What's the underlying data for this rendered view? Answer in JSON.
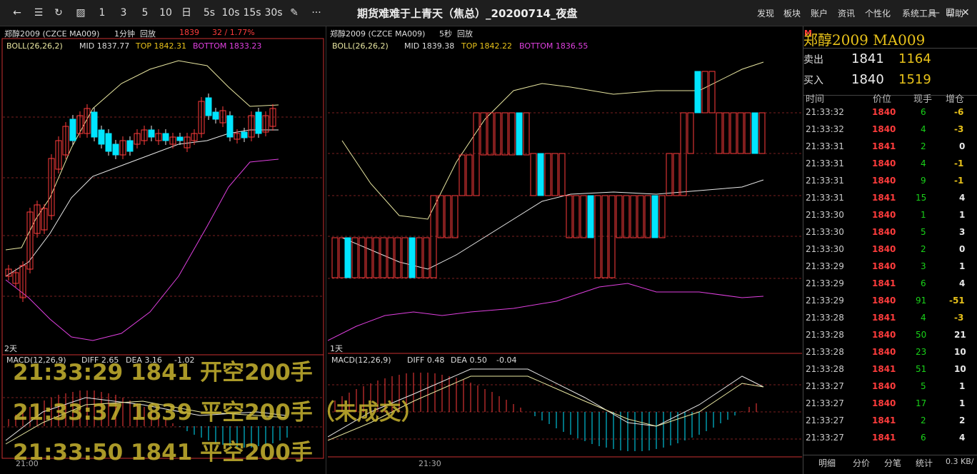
{
  "toolbar": {
    "periods": [
      "1",
      "3",
      "5",
      "10",
      "日",
      "5s",
      "10s",
      "15s",
      "30s"
    ],
    "more": "···",
    "title": "期货难难于上青天（焦总）_20200714_夜盘",
    "menus": [
      "发现",
      "板块",
      "账户",
      "资讯",
      "个性化",
      "系统工具",
      "帮助"
    ],
    "window_controls": [
      "—",
      "☐",
      "✕"
    ]
  },
  "left_chart": {
    "symbol": "郑醇2009 (CZCE MA009)",
    "period": "1分钟",
    "mode": "回放",
    "price": "1839",
    "change": "32 / 1.77%",
    "boll_label": "BOLL(26,26,2)",
    "boll_mid": "MID 1837.77",
    "boll_top": "TOP 1842.31",
    "boll_bottom": "BOTTOM 1833.23",
    "period_tag": "2天",
    "macd_label": "MACD(12,26,9)",
    "macd_diff": "DIFF 2.65",
    "macd_dea": "DEA 3.16",
    "macd_val": "-1.02",
    "time_label": "21:00"
  },
  "right_chart": {
    "symbol": "郑醇2009 (CZCE MA009)",
    "period": "5秒",
    "mode": "回放",
    "boll_label": "BOLL(26,26,2)",
    "boll_mid": "MID 1839.38",
    "boll_top": "TOP 1842.22",
    "boll_bottom": "BOTTOM 1836.55",
    "period_tag": "1天",
    "macd_label": "MACD(12,26,9)",
    "macd_diff": "DIFF 0.48",
    "macd_dea": "DEA 0.50",
    "macd_val": "-0.04",
    "time_label": "21:30"
  },
  "quote": {
    "title": "郑醇2009  MA009",
    "sell_label": "卖出",
    "sell_price": "1841",
    "sell_vol": "1164",
    "buy_label": "买入",
    "buy_price": "1840",
    "buy_vol": "1519",
    "col_time": "时间",
    "col_price": "价位",
    "col_vol": "现手",
    "col_oi": "增仓",
    "ticks": [
      {
        "t": "21:33:32",
        "p": "1840",
        "v": "6",
        "o": "-6"
      },
      {
        "t": "21:33:32",
        "p": "1840",
        "v": "4",
        "o": "-3"
      },
      {
        "t": "21:33:31",
        "p": "1841",
        "v": "2",
        "o": "0"
      },
      {
        "t": "21:33:31",
        "p": "1840",
        "v": "4",
        "o": "-1"
      },
      {
        "t": "21:33:31",
        "p": "1840",
        "v": "9",
        "o": "-1"
      },
      {
        "t": "21:33:31",
        "p": "1841",
        "v": "15",
        "o": "4"
      },
      {
        "t": "21:33:30",
        "p": "1840",
        "v": "1",
        "o": "1"
      },
      {
        "t": "21:33:30",
        "p": "1840",
        "v": "5",
        "o": "3"
      },
      {
        "t": "21:33:30",
        "p": "1840",
        "v": "2",
        "o": "0"
      },
      {
        "t": "21:33:29",
        "p": "1840",
        "v": "3",
        "o": "1"
      },
      {
        "t": "21:33:29",
        "p": "1841",
        "v": "6",
        "o": "4"
      },
      {
        "t": "21:33:29",
        "p": "1840",
        "v": "91",
        "o": "-51"
      },
      {
        "t": "21:33:28",
        "p": "1841",
        "v": "4",
        "o": "-3"
      },
      {
        "t": "21:33:28",
        "p": "1840",
        "v": "50",
        "o": "21"
      },
      {
        "t": "21:33:28",
        "p": "1840",
        "v": "23",
        "o": "10"
      },
      {
        "t": "21:33:28",
        "p": "1841",
        "v": "51",
        "o": "10"
      },
      {
        "t": "21:33:27",
        "p": "1840",
        "v": "5",
        "o": "1"
      },
      {
        "t": "21:33:27",
        "p": "1840",
        "v": "17",
        "o": "1"
      },
      {
        "t": "21:33:27",
        "p": "1841",
        "v": "2",
        "o": "2"
      },
      {
        "t": "21:33:27",
        "p": "1841",
        "v": "6",
        "o": "4"
      }
    ],
    "tabs": [
      "明细",
      "分价",
      "分笔",
      "统计"
    ],
    "net": "0.3 KB/"
  },
  "overlay_lines": [
    "21:33:29 1841 开空200手",
    "21:33:37 1839 平空200手（未成交）",
    "21:33:50 1841 平空200手"
  ],
  "colors": {
    "up": "#ff3c3c",
    "down": "#00e5ff",
    "mid": "#e8e8e8",
    "upper": "#e8e6a0",
    "lower": "#e040e0",
    "green": "#19d219",
    "orange": "#e0a050"
  }
}
